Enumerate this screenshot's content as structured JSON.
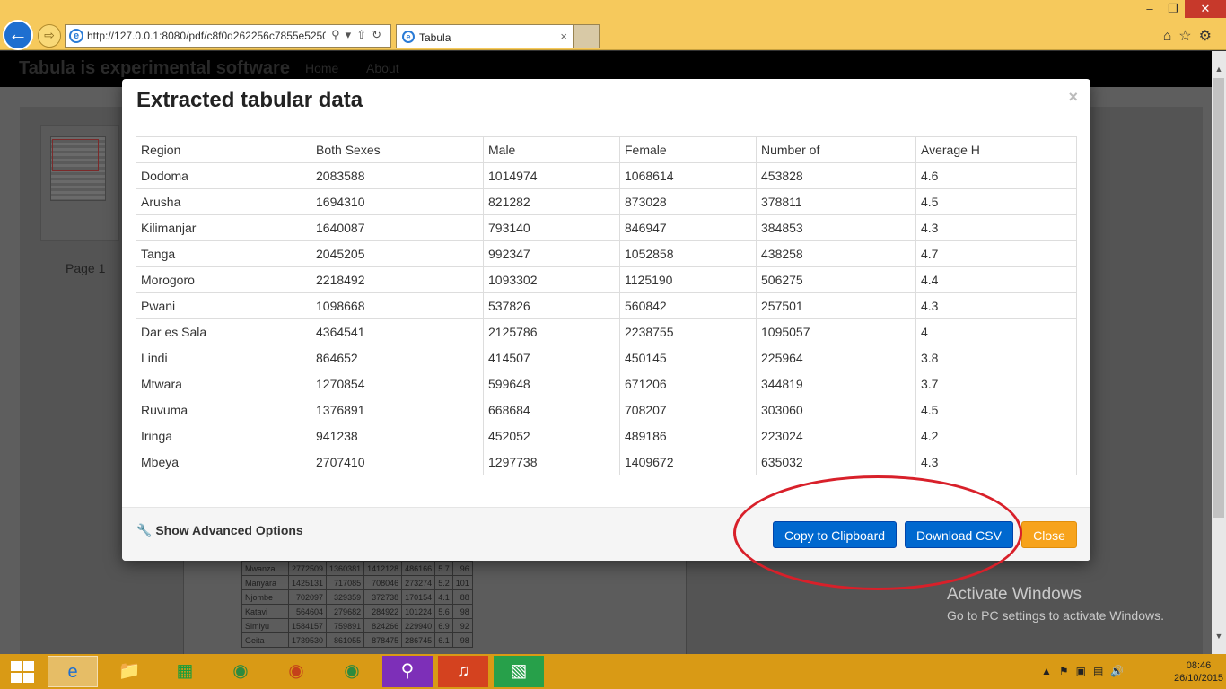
{
  "browser": {
    "url": "http://127.0.0.1:8080/pdf/c8f0d262256c7855e52505",
    "tab_title": "Tabula",
    "tab_close": "×"
  },
  "app": {
    "brand": "Tabula is experimental software",
    "nav": [
      "Home",
      "About"
    ],
    "page_label": "Page 1"
  },
  "modal": {
    "title": "Extracted tabular data",
    "close": "×",
    "table": {
      "headers": [
        "Region",
        "Both Sexes",
        "Male",
        "Female",
        "Number of",
        "Average H"
      ],
      "rows": [
        [
          "Dodoma",
          "2083588",
          "1014974",
          "1068614",
          "453828",
          "4.6"
        ],
        [
          "Arusha",
          "1694310",
          "821282",
          "873028",
          "378811",
          "4.5"
        ],
        [
          "Kilimanjar",
          "1640087",
          "793140",
          "846947",
          "384853",
          "4.3"
        ],
        [
          "Tanga",
          "2045205",
          "992347",
          "1052858",
          "438258",
          "4.7"
        ],
        [
          "Morogoro",
          "2218492",
          "1093302",
          "1125190",
          "506275",
          "4.4"
        ],
        [
          "Pwani",
          "1098668",
          "537826",
          "560842",
          "257501",
          "4.3"
        ],
        [
          "Dar es Sala",
          "4364541",
          "2125786",
          "2238755",
          "1095057",
          "4"
        ],
        [
          "Lindi",
          "864652",
          "414507",
          "450145",
          "225964",
          "3.8"
        ],
        [
          "Mtwara",
          "1270854",
          "599648",
          "671206",
          "344819",
          "3.7"
        ],
        [
          "Ruvuma",
          "1376891",
          "668684",
          "708207",
          "303060",
          "4.5"
        ],
        [
          "Iringa",
          "941238",
          "452052",
          "489186",
          "223024",
          "4.2"
        ],
        [
          "Mbeya",
          "2707410",
          "1297738",
          "1409672",
          "635032",
          "4.3"
        ]
      ]
    },
    "advanced_label": "Show Advanced Options",
    "copy_label": "Copy to Clipboard",
    "download_label": "Download CSV",
    "close_label": "Close"
  },
  "pdf_rows": [
    [
      "Mwanza",
      "2772509",
      "1360381",
      "1412128",
      "486166",
      "5.7",
      "96"
    ],
    [
      "Manyara",
      "1425131",
      "717085",
      "708046",
      "273274",
      "5.2",
      "101"
    ],
    [
      "Njombe",
      "702097",
      "329359",
      "372738",
      "170154",
      "4.1",
      "88"
    ],
    [
      "Katavi",
      "564604",
      "279682",
      "284922",
      "101224",
      "5.6",
      "98"
    ],
    [
      "Simiyu",
      "1584157",
      "759891",
      "824266",
      "229940",
      "6.9",
      "92"
    ],
    [
      "Geita",
      "1739530",
      "861055",
      "878475",
      "286745",
      "6.1",
      "98"
    ]
  ],
  "watermark": {
    "line1": "Activate Windows",
    "line2": "Go to PC settings to activate Windows."
  },
  "taskbar": {
    "time": "08:46",
    "date": "26/10/2015"
  },
  "colors": {
    "chrome": "#f6c95c",
    "taskbar": "#d99a15",
    "primary_button": "#0068cf",
    "warning_button": "#f7a31c",
    "annotation": "#d8202a"
  }
}
